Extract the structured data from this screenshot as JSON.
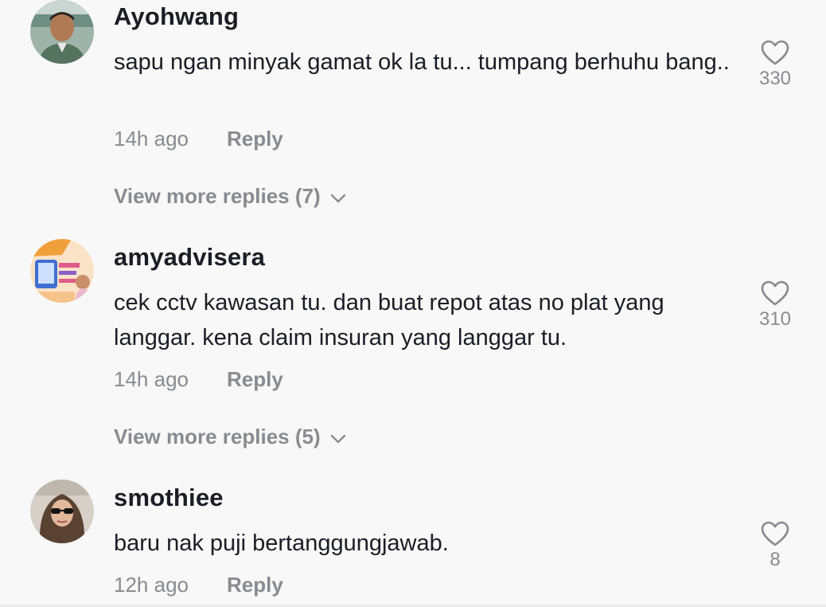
{
  "comments": [
    {
      "username": "Ayohwang",
      "text": "sapu ngan minyak gamat ok la tu... tumpang berhuhu bang..",
      "time": "14h ago",
      "reply_label": "Reply",
      "likes": "330",
      "view_more": "View more replies (7)"
    },
    {
      "username": "amyadvisera",
      "text": "cek cctv kawasan tu. dan buat repot atas no plat yang langgar. kena claim insuran yang langgar tu.",
      "time": "14h ago",
      "reply_label": "Reply",
      "likes": "310",
      "view_more": "View more replies (5)"
    },
    {
      "username": "smothiee",
      "text": "baru nak puji bertanggungjawab.",
      "time": "12h ago",
      "reply_label": "Reply",
      "likes": "8"
    }
  ],
  "icons": {
    "like": "heart-outline-icon",
    "expand": "chevron-down-icon"
  },
  "colors": {
    "background": "#f8f8f8",
    "primary_text": "#1c1d25",
    "secondary_text": "#8a8b91"
  }
}
